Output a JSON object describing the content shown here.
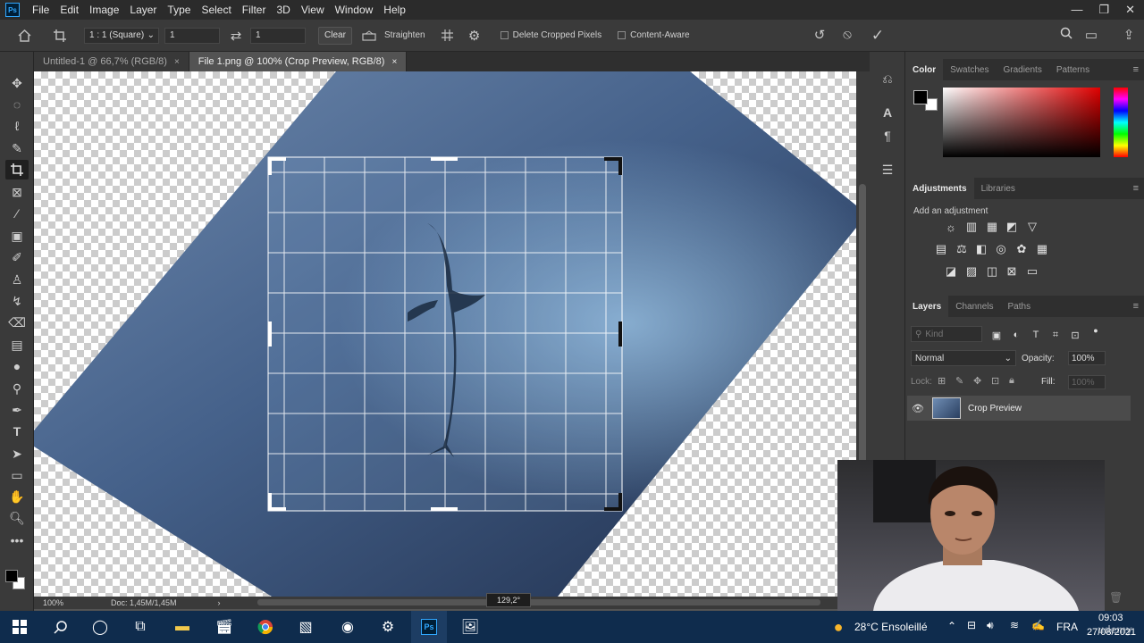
{
  "app": {
    "logo": "Ps"
  },
  "menu": [
    "File",
    "Edit",
    "Image",
    "Layer",
    "Type",
    "Select",
    "Filter",
    "3D",
    "View",
    "Window",
    "Help"
  ],
  "window_controls": [
    "—",
    "❐",
    "✕"
  ],
  "options": {
    "home_icon": "home-icon",
    "ratio_value": "1 : 1 (Square)",
    "width_value": "1",
    "height_value": "1",
    "clear_label": "Clear",
    "straighten_label": "Straighten",
    "delete_cropped_label": "Delete Cropped Pixels",
    "content_aware_label": "Content-Aware"
  },
  "tabs": [
    {
      "label": "Untitled-1 @ 66,7% (RGB/8)",
      "close": "×"
    },
    {
      "label": "File 1.png @ 100% (Crop Preview, RGB/8)",
      "close": "×"
    }
  ],
  "status": {
    "zoom": "100%",
    "doc": "Doc: 1,45M/1,45M",
    "angle": "129,2°"
  },
  "color_panel": {
    "tabs": [
      "Color",
      "Swatches",
      "Gradients",
      "Patterns"
    ],
    "foreground": "#000000",
    "background": "#ffffff"
  },
  "adjustments_panel": {
    "tabs": [
      "Adjustments",
      "Libraries"
    ],
    "hint": "Add an adjustment"
  },
  "layers_panel": {
    "tabs": [
      "Layers",
      "Channels",
      "Paths"
    ],
    "filter_placeholder": "Kind",
    "blend_mode": "Normal",
    "opacity_label": "Opacity:",
    "opacity_value": "100%",
    "lock_label": "Lock:",
    "fill_label": "Fill:",
    "fill_value": "100%",
    "layers": [
      {
        "name": "Crop Preview",
        "visible": true
      }
    ]
  },
  "taskbar": {
    "weather": "28°C  Ensoleillé",
    "language": "FRA",
    "time": "09:03",
    "date": "27/08/2021",
    "watermark": "udemy"
  }
}
